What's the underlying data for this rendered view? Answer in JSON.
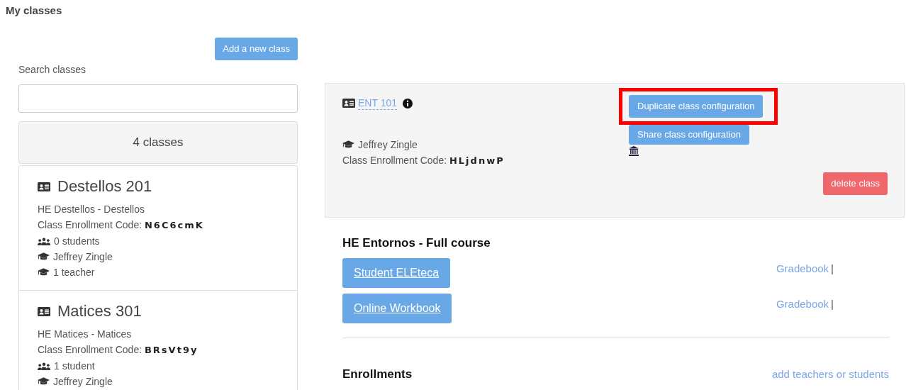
{
  "page_title": "My classes",
  "add_class_button": "Add a new class",
  "search": {
    "label": "Search classes"
  },
  "class_count": "4 classes",
  "classes": [
    {
      "name": "Destellos 201",
      "course": "HE Destellos - Destellos",
      "code_label": "Class Enrollment Code:",
      "code": "N6C6cmK",
      "students": "0 students",
      "teacher": "Jeffrey Zingle",
      "teachers": "1 teacher"
    },
    {
      "name": "Matices 301",
      "course": "HE Matices - Matices",
      "code_label": "Class Enrollment Code:",
      "code": "BRsVt9y",
      "students": "1 student",
      "teacher": "Jeffrey Zingle"
    }
  ],
  "detail": {
    "class_name": "ENT 101",
    "teacher": "Jeffrey Zingle",
    "code_label": "Class Enrollment Code:",
    "code": "HLjdnwP",
    "duplicate_button": "Duplicate class configuration",
    "duplicate_highlighted": true,
    "share_button": "Share class configuration",
    "delete_button": "delete class"
  },
  "course": {
    "title": "HE Entornos - Full course",
    "resources": [
      {
        "label": "Student ELEteca",
        "link": "Gradebook",
        "separator": "|"
      },
      {
        "label": "Online Workbook",
        "link": "Gradebook",
        "separator": "|"
      }
    ]
  },
  "enrollments": {
    "title": "Enrollments",
    "link": "add teachers or students"
  }
}
